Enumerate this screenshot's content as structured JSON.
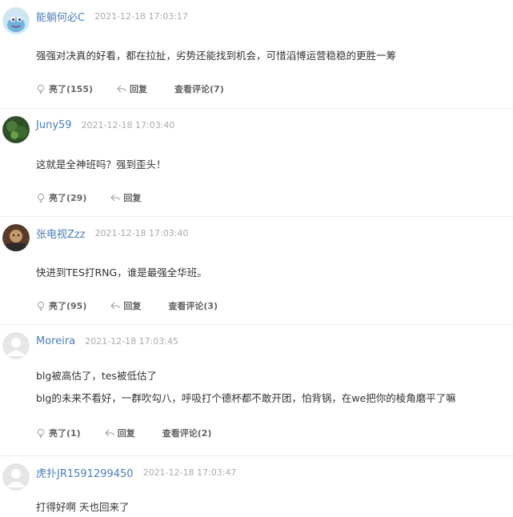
{
  "comments": [
    {
      "username": "能躺何必C",
      "time": "2021-12-18 17:03:17",
      "lines": [
        "强强对决真的好看，都在拉扯，劣势还能找到机会，可惜滔博运营稳稳的更胜一筹"
      ],
      "like_label": "亮了(155)",
      "reply_label": "回复",
      "view_label": "查看评论(7)"
    },
    {
      "username": "Juny59",
      "time": "2021-12-18 17:03:40",
      "lines": [
        "这就是全神班吗？强到歪头！"
      ],
      "like_label": "亮了(29)",
      "reply_label": "回复"
    },
    {
      "username": "张电视Zzz",
      "time": "2021-12-18 17:03:40",
      "lines": [
        "快进到TES打RNG，谁是最强全华班。"
      ],
      "like_label": "亮了(95)",
      "reply_label": "回复",
      "view_label": "查看评论(3)"
    },
    {
      "username": "Moreira",
      "time": "2021-12-18 17:03:45",
      "lines": [
        "blg被高估了，tes被低估了",
        "blg的未来不看好，一群吹勾八，呼吸打个德杯都不敢开团，怕背锅，在we把你的棱角磨平了嘛"
      ],
      "like_label": "亮了(1)",
      "reply_label": "回复",
      "view_label": "查看评论(2)"
    },
    {
      "username": "虎扑JR1591299450",
      "time": "2021-12-18 17:03:47",
      "lines": [
        "打得好啊 天也回来了"
      ]
    }
  ],
  "colors": {
    "username": "#4a7dbf",
    "time": "#aaaaaa",
    "divider": "#eeeeee"
  }
}
